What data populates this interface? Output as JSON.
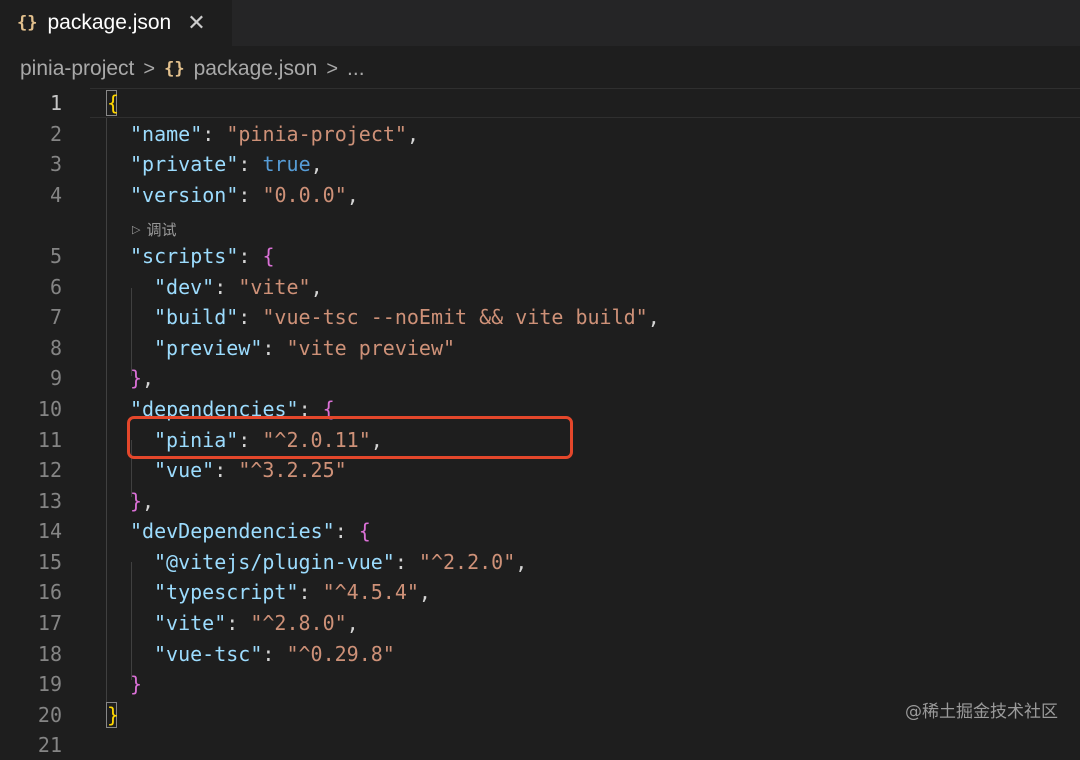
{
  "tab": {
    "icon": "{}",
    "label": "package.json",
    "close": "✕"
  },
  "breadcrumb": {
    "project": "pinia-project",
    "sep": ">",
    "icon": "{}",
    "file": "package.json",
    "more": "..."
  },
  "codelens": {
    "icon": "▷",
    "label": "调试"
  },
  "line_numbers": [
    "1",
    "2",
    "3",
    "4",
    "5",
    "6",
    "7",
    "8",
    "9",
    "10",
    "11",
    "12",
    "13",
    "14",
    "15",
    "16",
    "17",
    "18",
    "19",
    "20",
    "21"
  ],
  "code": {
    "l1": {
      "open": "{"
    },
    "l2": {
      "key": "\"name\"",
      "colon": ": ",
      "val": "\"pinia-project\"",
      "comma": ","
    },
    "l3": {
      "key": "\"private\"",
      "colon": ": ",
      "val": "true",
      "comma": ","
    },
    "l4": {
      "key": "\"version\"",
      "colon": ": ",
      "val": "\"0.0.0\"",
      "comma": ","
    },
    "l5": {
      "key": "\"scripts\"",
      "colon": ": ",
      "open": "{"
    },
    "l6": {
      "key": "\"dev\"",
      "colon": ": ",
      "val": "\"vite\"",
      "comma": ","
    },
    "l7": {
      "key": "\"build\"",
      "colon": ": ",
      "val": "\"vue-tsc --noEmit && vite build\"",
      "comma": ","
    },
    "l8": {
      "key": "\"preview\"",
      "colon": ": ",
      "val": "\"vite preview\""
    },
    "l9": {
      "close": "}",
      "comma": ","
    },
    "l10": {
      "key": "\"dependencies\"",
      "colon": ": ",
      "open": "{"
    },
    "l11": {
      "key": "\"pinia\"",
      "colon": ": ",
      "val": "\"^2.0.11\"",
      "comma": ","
    },
    "l12": {
      "key": "\"vue\"",
      "colon": ": ",
      "val": "\"^3.2.25\""
    },
    "l13": {
      "close": "}",
      "comma": ","
    },
    "l14": {
      "key": "\"devDependencies\"",
      "colon": ": ",
      "open": "{"
    },
    "l15": {
      "key": "\"@vitejs/plugin-vue\"",
      "colon": ": ",
      "val": "\"^2.2.0\"",
      "comma": ","
    },
    "l16": {
      "key": "\"typescript\"",
      "colon": ": ",
      "val": "\"^4.5.4\"",
      "comma": ","
    },
    "l17": {
      "key": "\"vite\"",
      "colon": ": ",
      "val": "\"^2.8.0\"",
      "comma": ","
    },
    "l18": {
      "key": "\"vue-tsc\"",
      "colon": ": ",
      "val": "\"^0.29.8\""
    },
    "l19": {
      "close": "}"
    },
    "l20": {
      "close": "}"
    }
  },
  "watermark": "@稀土掘金技术社区",
  "colors": {
    "background": "#1e1e1e",
    "key": "#9cdcfe",
    "string": "#ce9178",
    "keyword": "#569cd6",
    "bracket_outer": "#ffd700",
    "bracket_inner": "#da70d6",
    "highlight_box": "#e4472b"
  }
}
